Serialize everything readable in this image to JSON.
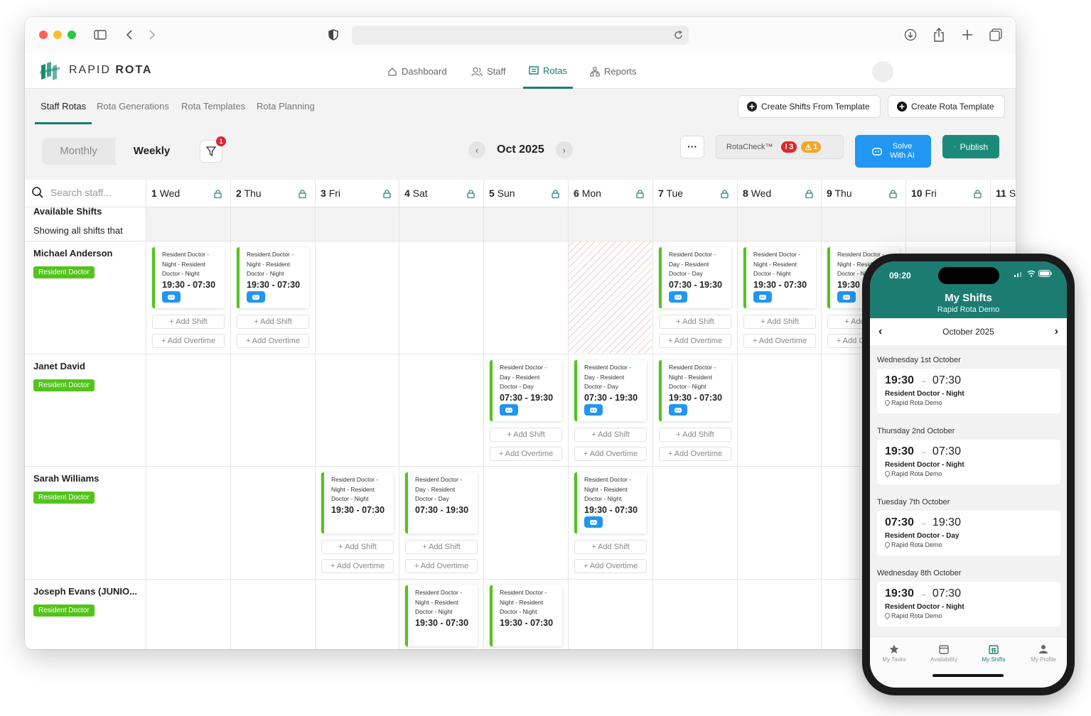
{
  "brand": {
    "name_light": "RAPID ",
    "name_bold": "ROTA"
  },
  "nav": {
    "dashboard": "Dashboard",
    "staff": "Staff",
    "rotas": "Rotas",
    "reports": "Reports"
  },
  "subnav": {
    "tabs": [
      "Staff Rotas",
      "Rota Generations",
      "Rota Templates",
      "Rota Planning"
    ],
    "create_from_template": "Create Shifts From Template",
    "create_rota_template": "Create Rota Template"
  },
  "toolbar": {
    "monthly": "Monthly",
    "weekly": "Weekly",
    "filter_count": "1",
    "month": "Oct 2025",
    "more": "···",
    "rotacheck": "RotaCheck™",
    "errors": "3",
    "warnings": "1",
    "solve_line1": "Solve",
    "solve_line2": "With AI",
    "publish": "Publish"
  },
  "grid": {
    "search_placeholder": "Search staff...",
    "available_shifts": "Available Shifts",
    "showing": "Showing all shifts that",
    "days": [
      {
        "num": "1",
        "name": "Wed"
      },
      {
        "num": "2",
        "name": "Thu"
      },
      {
        "num": "3",
        "name": "Fri"
      },
      {
        "num": "4",
        "name": "Sat"
      },
      {
        "num": "5",
        "name": "Sun"
      },
      {
        "num": "6",
        "name": "Mon"
      },
      {
        "num": "7",
        "name": "Tue"
      },
      {
        "num": "8",
        "name": "Wed"
      },
      {
        "num": "9",
        "name": "Thu"
      },
      {
        "num": "10",
        "name": "Fri"
      },
      {
        "num": "11",
        "name": "Sa"
      }
    ],
    "add_shift": "+ Add Shift",
    "add_overtime": "+ Add Overtime",
    "staff": [
      {
        "name": "Michael Anderson",
        "role": "Resident Doctor"
      },
      {
        "name": "Janet David",
        "role": "Resident Doctor"
      },
      {
        "name": "Sarah Williams",
        "role": "Resident Doctor"
      },
      {
        "name": "Joseph Evans (JUNIO...",
        "role": "Resident Doctor"
      }
    ],
    "shift_types": {
      "night": {
        "l1": "Resident Doctor -",
        "l2": "Night - Resident",
        "l3": "Doctor - Night",
        "time": "19:30 - 07:30"
      },
      "day": {
        "l1": "Resident Doctor -",
        "l2": "Day - Resident",
        "l3": "Doctor - Day",
        "time": "07:30 - 19:30"
      }
    }
  },
  "phone": {
    "time": "09:20",
    "title": "My Shifts",
    "subtitle": "Rapid Rota Demo",
    "month": "October 2025",
    "shifts": [
      {
        "day": "Wednesday 1st October",
        "start": "19:30",
        "end": "07:30",
        "role": "Resident Doctor - Night",
        "location": "Rapid Rota Demo"
      },
      {
        "day": "Thursday 2nd October",
        "start": "19:30",
        "end": "07:30",
        "role": "Resident Doctor - Night",
        "location": "Rapid Rota Demo"
      },
      {
        "day": "Tuesday 7th October",
        "start": "07:30",
        "end": "19:30",
        "role": "Resident Doctor - Day",
        "location": "Rapid Rota Demo"
      },
      {
        "day": "Wednesday 8th October",
        "start": "19:30",
        "end": "07:30",
        "role": "Resident Doctor - Night",
        "location": "Rapid Rota Demo"
      }
    ],
    "tabs": [
      "My Tasks",
      "Availability",
      "My Shifts",
      "My Profile"
    ]
  },
  "colors": {
    "brand": "#1c7c72",
    "role_badge": "#52c41a",
    "solve": "#2196f3",
    "error": "#e0262b",
    "warning": "#f5a623"
  }
}
